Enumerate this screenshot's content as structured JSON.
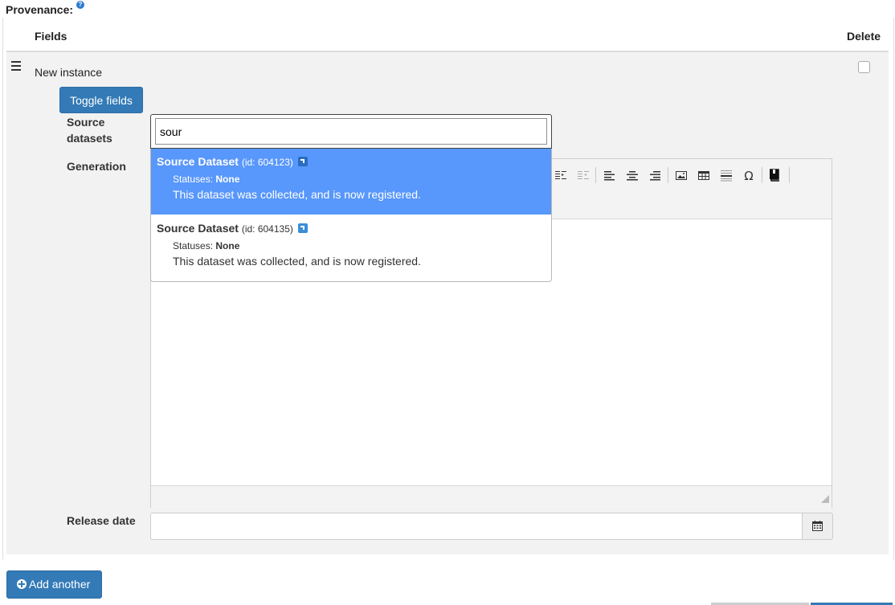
{
  "header": {
    "provenance_label": "Provenance:",
    "help_glyph": "?"
  },
  "table": {
    "fields_header": "Fields",
    "delete_header": "Delete"
  },
  "instance": {
    "label": "New instance",
    "toggle_button": "Toggle fields"
  },
  "form": {
    "source_label": "Source datasets",
    "generation_label": "Generation",
    "release_label": "Release date"
  },
  "search": {
    "value": "sour"
  },
  "results": [
    {
      "title": "Source Dataset",
      "id": "(id: 604123)",
      "status_label": "Statuses:",
      "status_value": "None",
      "description": "This dataset was collected, and is now registered."
    },
    {
      "title": "Source Dataset",
      "id": "(id: 604135)",
      "status_label": "Statuses:",
      "status_value": "None",
      "description": "This dataset was collected, and is now registered."
    }
  ],
  "add_button": {
    "label": "Add another"
  },
  "colors": {
    "primary": "#337ab7",
    "highlight": "#5897fb",
    "panel": "#f2f2f2"
  },
  "icons": [
    "help-icon",
    "drag-handle-icon",
    "external-link-icon",
    "calendar-icon",
    "plus-circle-icon",
    "indent-icon",
    "outdent-icon",
    "align-left-icon",
    "align-center-icon",
    "align-right-icon",
    "image-icon",
    "table-icon",
    "horizontal-rule-icon",
    "omega-icon",
    "bookmark-icon"
  ]
}
